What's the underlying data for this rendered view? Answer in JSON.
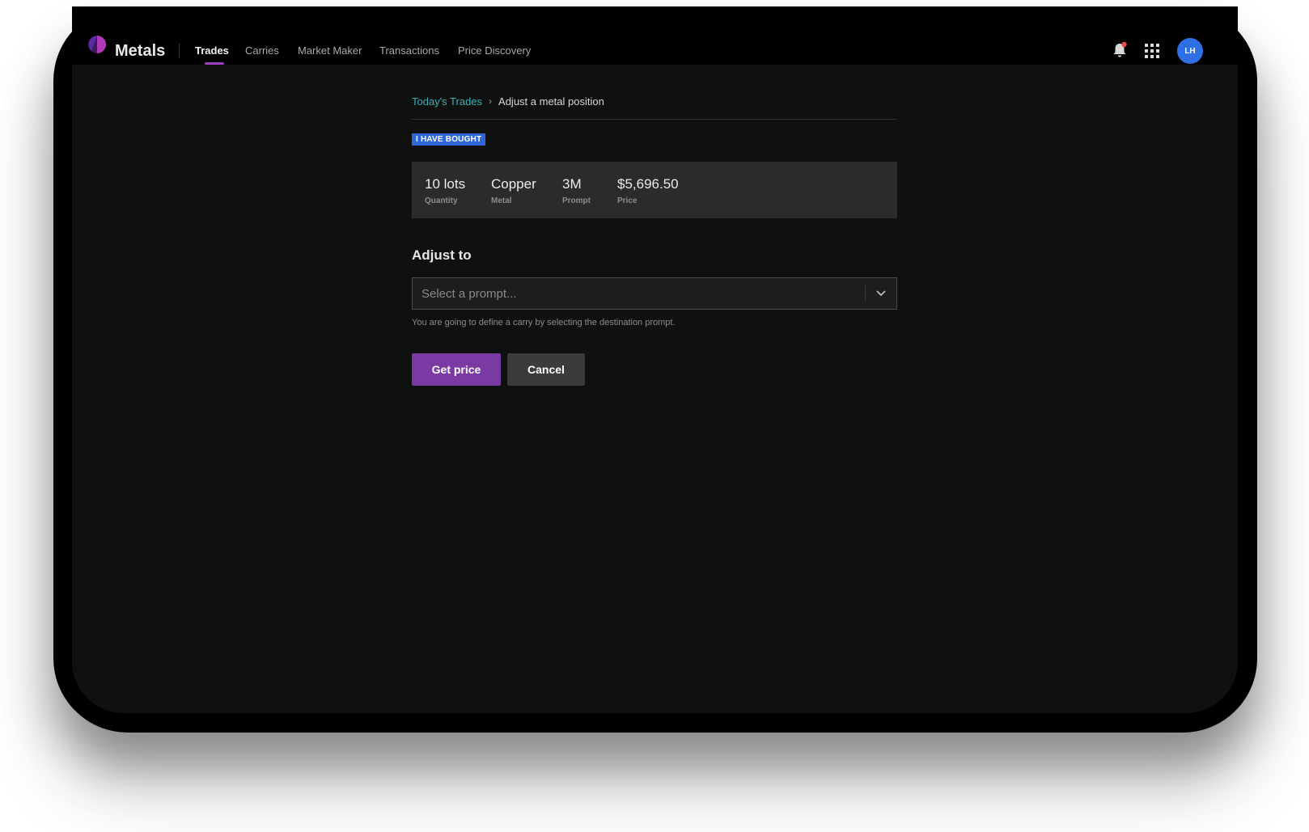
{
  "app": {
    "brand": "Metals",
    "user_initials": "LH"
  },
  "nav": {
    "items": [
      {
        "label": "Trades",
        "active": true
      },
      {
        "label": "Carries",
        "active": false
      },
      {
        "label": "Market Maker",
        "active": false
      },
      {
        "label": "Transactions",
        "active": false
      },
      {
        "label": "Price Discovery",
        "active": false
      }
    ]
  },
  "icons": {
    "logo": "metals-logo-icon",
    "notifications": "bell-icon",
    "apps": "grid-icon",
    "dropdown": "chevron-down-icon",
    "breadcrumb_separator": "chevron-right-icon"
  },
  "breadcrumb": {
    "parent": "Today's Trades",
    "current": "Adjust a metal position"
  },
  "position": {
    "badge": "I HAVE BOUGHT",
    "fields": [
      {
        "value": "10 lots",
        "label": "Quantity"
      },
      {
        "value": "Copper",
        "label": "Metal"
      },
      {
        "value": "3M",
        "label": "Prompt"
      },
      {
        "value": "$5,696.50",
        "label": "Price"
      }
    ]
  },
  "adjust": {
    "title": "Adjust to",
    "select_placeholder": "Select a prompt...",
    "helper": "You are going to define a carry by selecting the destination prompt."
  },
  "actions": {
    "primary": "Get price",
    "secondary": "Cancel"
  },
  "colors": {
    "accent": "#7b3aa3",
    "badge": "#2e68d8",
    "link": "#3bb0b7",
    "notification_dot": "#e5484d",
    "avatar": "#2f6fe4"
  }
}
